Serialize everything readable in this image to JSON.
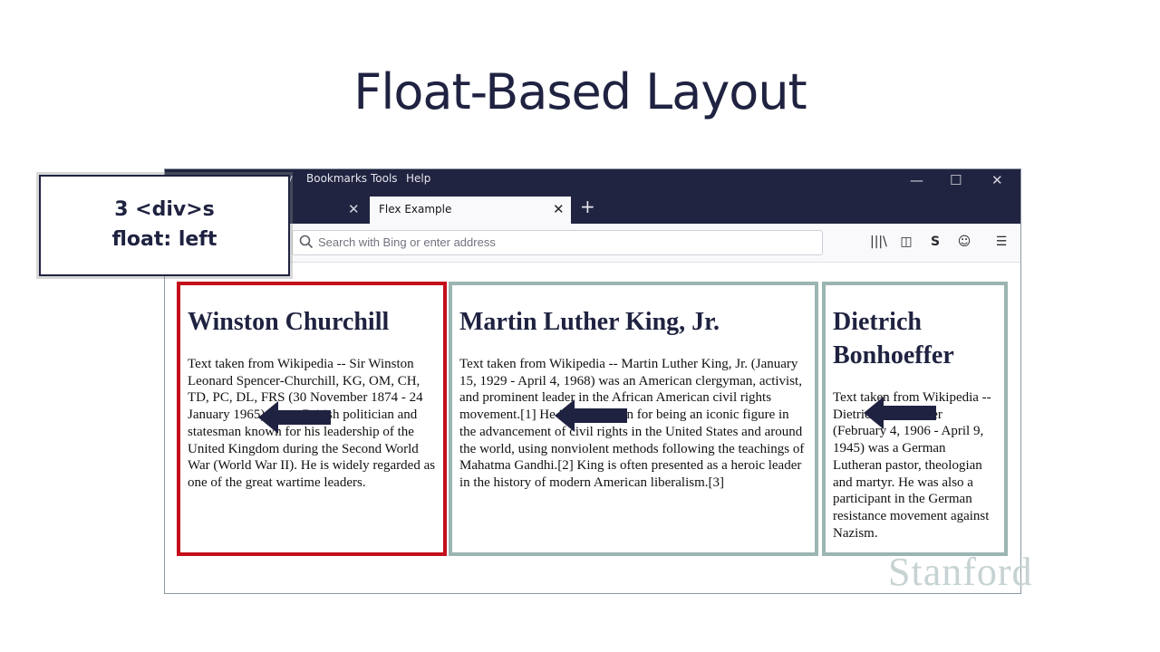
{
  "slide": {
    "title": "Float-Based Layout"
  },
  "callout": {
    "line1": "3 <div>s",
    "line2": "float: left"
  },
  "browser": {
    "menu": [
      "y",
      "Bookmarks",
      "Tools",
      "Help"
    ],
    "window_controls": {
      "minimize": "—",
      "maximize": "☐",
      "close": "✕"
    },
    "tabs": [
      {
        "title": "",
        "close": "✕",
        "active": false
      },
      {
        "title": "Flex Example",
        "close": "✕",
        "active": true
      }
    ],
    "new_tab": "+",
    "urlbar": {
      "placeholder": "Search with Bing or enter address"
    },
    "toolbar": {
      "library": "|||\\",
      "sidebar": "◫",
      "s_icon": "S",
      "account": "☺",
      "menu": "☰"
    }
  },
  "page": {
    "columns": [
      {
        "heading": "Winston Churchill",
        "text": "Text taken from Wikipedia -- Sir Winston Leonard Spencer-Churchill, KG, OM, CH, TD, PC, DL, FRS (30 November 1874 - 24 January 1965) was a British politician and statesman known for his leadership of the United Kingdom during the Second World War (World War II). He is widely regarded as one of the great wartime leaders."
      },
      {
        "heading": "Martin Luther King, Jr.",
        "text": "Text taken from Wikipedia -- Martin Luther King, Jr. (January 15, 1929 - April 4, 1968) was an American clergyman, activist, and prominent leader in the African American civil rights movement.[1] He is best known for being an iconic figure in the advancement of civil rights in the United States and around the world, using nonviolent methods following the teachings of Mahatma Gandhi.[2] King is often presented as a heroic leader in the history of modern American liberalism.[3]"
      },
      {
        "heading": "Dietrich Bonhoeffer",
        "text": "Text taken from Wikipedia -- Dietrich Bonhoeffer (February 4, 1906 - April 9, 1945) was a German Lutheran pastor, theologian and martyr. He was also a participant in the German resistance movement against Nazism."
      }
    ]
  },
  "watermark": "Stanford",
  "colors": {
    "navy": "#1f2240",
    "red_border": "#c40f1a",
    "teal_border": "#9bb5b2"
  }
}
